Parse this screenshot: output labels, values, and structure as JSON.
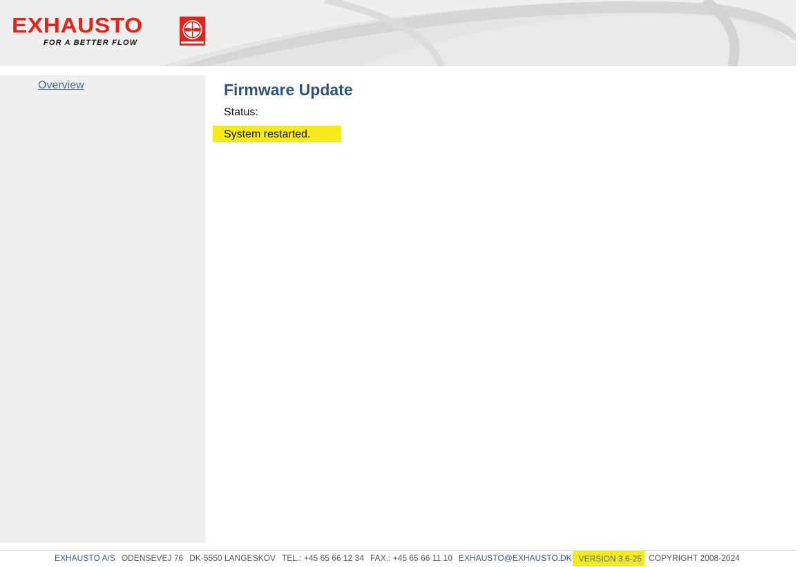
{
  "header": {
    "brand_name": "EXHAUSTO",
    "tagline": "FOR A BETTER FLOW"
  },
  "sidebar": {
    "items": [
      {
        "label": "Overview"
      }
    ]
  },
  "main": {
    "title": "Firmware Update",
    "status_label": "Status:",
    "status_message": "System restarted."
  },
  "footer": {
    "company": "EXHAUSTO A/S",
    "address": "ODENSEVEJ 76",
    "city": "DK-5550 LANGESKOV",
    "tel": "TEL.: +45 65 66 12 34",
    "fax": "FAX.: +45 65 66 11 10",
    "email": "EXHAUSTO@EXHAUSTO.DK",
    "version": "VERSION 3.6-25",
    "copyright": "COPYRIGHT 2008-2024"
  },
  "colors": {
    "brand_red": "#e2231a",
    "highlight_yellow": "#f7ea1a",
    "title_blue": "#2e5577",
    "link_blue": "#3a6aa5",
    "panel_gray": "#efefef"
  }
}
